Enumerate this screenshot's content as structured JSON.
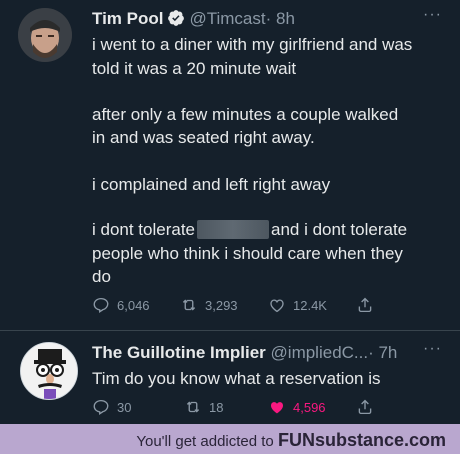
{
  "tweet1": {
    "name": "Tim Pool",
    "handle": "@Timcast",
    "time": "· 8h",
    "more": "···",
    "lines": [
      "i went to a diner with my girlfriend and was",
      "told it was a 20 minute wait",
      "after only a few minutes a couple walked",
      "in and was seated right away.",
      "i complained and left right away",
      "i dont tolerate",
      "and i dont tolerate",
      "people who think i should care when they",
      "do"
    ],
    "replies": "6,046",
    "retweets": "3,293",
    "likes": "12.4K",
    "icons": [
      "reply-icon",
      "retweet-icon",
      "heart-icon",
      "share-icon"
    ]
  },
  "tweet2": {
    "name": "The Guillotine Implier",
    "handle": "@impliedC...",
    "time": "· 7h",
    "more": "···",
    "text": "Tim do you know what a reservation is",
    "replies": "30",
    "retweets": "18",
    "likes": "4,596",
    "like_color": "#f91880"
  },
  "footer": {
    "prefix": "You'll get addicted to ",
    "brand": "FUNsubstance.com",
    "background": "#b9a7cf"
  }
}
